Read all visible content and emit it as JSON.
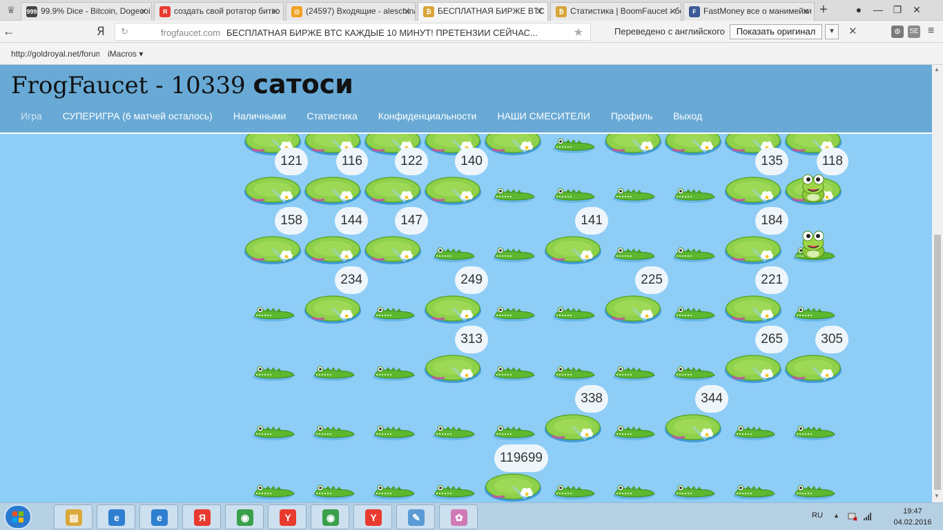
{
  "browser": {
    "tabs": [
      {
        "label": "99.9% Dice - Bitcoin, Dogecoi",
        "icon": "dice-favicon",
        "favtext": "999",
        "color": "#444444"
      },
      {
        "label": "создать свой ротатор битко",
        "icon": "yandex-favicon",
        "favtext": "Я",
        "color": "#e83a2f"
      },
      {
        "label": "(24597) Входящие - aleschina",
        "icon": "mail-favicon",
        "favtext": "@",
        "color": "#f0a020"
      },
      {
        "label": "БЕСПЛАТНАЯ БИРЖЕ BTC",
        "icon": "bitcoin-favicon",
        "favtext": "₿",
        "color": "#d7a437",
        "active": true
      },
      {
        "label": "Статистика | BoomFaucet - бе",
        "icon": "bitcoin-favicon",
        "favtext": "₿",
        "color": "#d7a437"
      },
      {
        "label": "FastMoney все о манимейки",
        "icon": "facebook-favicon",
        "favtext": "F",
        "color": "#3b5998"
      }
    ],
    "new_tab": "+",
    "address": {
      "domain": "frogfaucet.com",
      "title": "БЕСПЛАТНАЯ БИРЖЕ BTC КАЖДЫЕ 10 МИНУТ! ПРЕТЕНЗИИ СЕЙЧАС...",
      "yandex_button": "Я"
    },
    "translate": {
      "status": "Переведено с английского",
      "button": "Показать оригинал"
    },
    "bookmarks": [
      {
        "label": "http://goldroyal.net/forum"
      },
      {
        "label": "iMacros ▾"
      }
    ]
  },
  "site": {
    "title_prefix": "FrogFaucet - 10339",
    "title_unit": "сатоси",
    "nav": [
      {
        "label": "Игра",
        "current": true
      },
      {
        "label": "СУПЕРИГРА (6 матчей осталось)"
      },
      {
        "label": "Наличными"
      },
      {
        "label": "Статистика"
      },
      {
        "label": "Конфиденциальности"
      },
      {
        "label": "НАШИ СМЕСИТЕЛИ"
      },
      {
        "label": "Профиль"
      },
      {
        "label": "Выход"
      }
    ]
  },
  "game": {
    "columns": 10,
    "rows": [
      [
        "pad",
        "pad",
        "pad",
        "pad",
        "pad",
        "croc",
        "pad",
        "pad",
        "pad",
        "pad"
      ],
      [
        {
          "type": "pad",
          "value": "121"
        },
        {
          "type": "pad",
          "value": "116"
        },
        {
          "type": "pad",
          "value": "122"
        },
        {
          "type": "pad",
          "value": "140"
        },
        "croc",
        "croc",
        "croc",
        "croc",
        {
          "type": "pad",
          "value": "135"
        },
        {
          "type": "pad",
          "value": "118",
          "frog": true
        }
      ],
      [
        {
          "type": "pad",
          "value": "158"
        },
        {
          "type": "pad",
          "value": "144"
        },
        {
          "type": "pad",
          "value": "147"
        },
        "croc",
        "croc",
        {
          "type": "pad",
          "value": "141"
        },
        "croc",
        "croc",
        {
          "type": "pad",
          "value": "184"
        },
        {
          "type": "croc",
          "frog": true
        }
      ],
      [
        "croc",
        {
          "type": "pad",
          "value": "234"
        },
        "croc",
        {
          "type": "pad",
          "value": "249"
        },
        "croc",
        "croc",
        {
          "type": "pad",
          "value": "225"
        },
        "croc",
        {
          "type": "pad",
          "value": "221"
        },
        "croc"
      ],
      [
        "croc",
        "croc",
        "croc",
        {
          "type": "pad",
          "value": "313"
        },
        "croc",
        "croc",
        "croc",
        "croc",
        {
          "type": "pad",
          "value": "265"
        },
        {
          "type": "pad",
          "value": "305"
        }
      ],
      [
        "croc",
        "croc",
        "croc",
        "croc",
        "croc",
        {
          "type": "pad",
          "value": "338"
        },
        "croc",
        {
          "type": "pad",
          "value": "344"
        },
        "croc",
        "croc"
      ],
      [
        "croc",
        "croc",
        "croc",
        "croc",
        {
          "type": "pad",
          "value": "119699"
        },
        "croc",
        "croc",
        "croc",
        "croc",
        "croc"
      ]
    ]
  },
  "taskbar": {
    "apps": [
      {
        "icon": "explorer-icon",
        "text": "▤",
        "color": "#d9a93a"
      },
      {
        "icon": "ie-icon",
        "text": "e",
        "color": "#2f7fd1"
      },
      {
        "icon": "ie-icon",
        "text": "e",
        "color": "#2f7fd1"
      },
      {
        "icon": "yandex-icon",
        "text": "Я",
        "color": "#e83a2f"
      },
      {
        "icon": "chrome-icon",
        "text": "◉",
        "color": "#3aa04a"
      },
      {
        "icon": "yandex-browser-icon",
        "text": "Y",
        "color": "#e83a2f"
      },
      {
        "icon": "chrome-icon",
        "text": "◉",
        "color": "#3aa04a"
      },
      {
        "icon": "yandex-browser-icon",
        "text": "Y",
        "color": "#e83a2f"
      },
      {
        "icon": "notepad-icon",
        "text": "✎",
        "color": "#5b9bd5"
      },
      {
        "icon": "paint-icon",
        "text": "✿",
        "color": "#d07ab6"
      }
    ],
    "language": "RU",
    "time": "19:47",
    "date": "04.02.2016"
  }
}
